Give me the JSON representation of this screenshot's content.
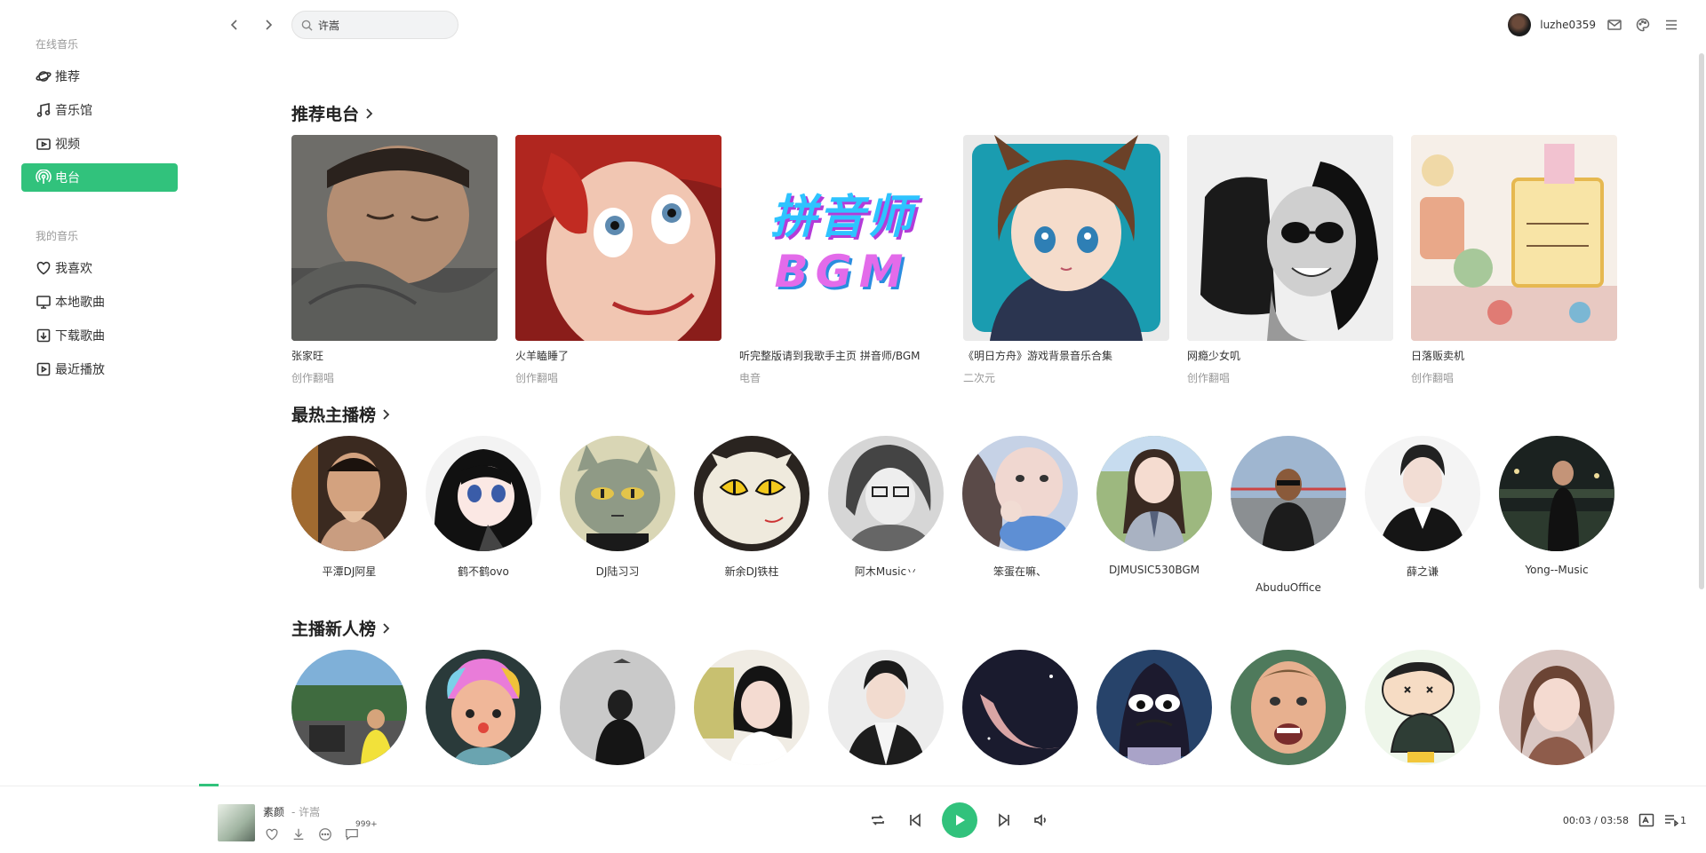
{
  "sidebar": {
    "online_title": "在线音乐",
    "online_items": [
      {
        "label": "推荐",
        "icon": "planet-icon"
      },
      {
        "label": "音乐馆",
        "icon": "music-note-icon"
      },
      {
        "label": "视频",
        "icon": "video-icon"
      },
      {
        "label": "电台",
        "icon": "radio-icon",
        "active": true
      }
    ],
    "mine_title": "我的音乐",
    "mine_items": [
      {
        "label": "我喜欢",
        "icon": "heart-icon"
      },
      {
        "label": "本地歌曲",
        "icon": "monitor-icon"
      },
      {
        "label": "下载歌曲",
        "icon": "download-icon"
      },
      {
        "label": "最近播放",
        "icon": "recent-play-icon"
      }
    ]
  },
  "header": {
    "search_value": "许嵩",
    "username": "luzhe0359"
  },
  "sections": {
    "radio_title": "推荐电台",
    "hot_anchor_title": "最热主播榜",
    "new_anchor_title": "主播新人榜"
  },
  "radios": [
    {
      "name": "张家旺",
      "tag": "创作翻唱"
    },
    {
      "name": "火羊瞌睡了",
      "tag": "创作翻唱"
    },
    {
      "name": "听完整版请到我歌手主页 拼音师/BGM",
      "tag": "电音",
      "cover_text_1": "拼音师",
      "cover_text_2": "BGM"
    },
    {
      "name": "《明日方舟》游戏背景音乐合集",
      "tag": "二次元"
    },
    {
      "name": "网瘾少女叽",
      "tag": "创作翻唱"
    },
    {
      "name": "日落贩卖机",
      "tag": "创作翻唱"
    }
  ],
  "hot_anchors": [
    {
      "name": "平潭DJ阿星"
    },
    {
      "name": "鹤不鹤ovo"
    },
    {
      "name": "DJ陆习习"
    },
    {
      "name": "新余DJ铁柱"
    },
    {
      "name": "阿木Music丷"
    },
    {
      "name": "笨蛋在嘛、"
    },
    {
      "name": "DJMUSIC530BGM"
    },
    {
      "name": "AbuduOffice"
    },
    {
      "name": "薛之谦"
    },
    {
      "name": "Yong--Music"
    }
  ],
  "player": {
    "song_title": "素颜",
    "song_artist": "- 许嵩",
    "comment_count": "999+",
    "time": "00:03 / 03:58",
    "playlist_count": "1",
    "progress_fraction": 0.013
  },
  "colors": {
    "accent": "#31c27c"
  }
}
